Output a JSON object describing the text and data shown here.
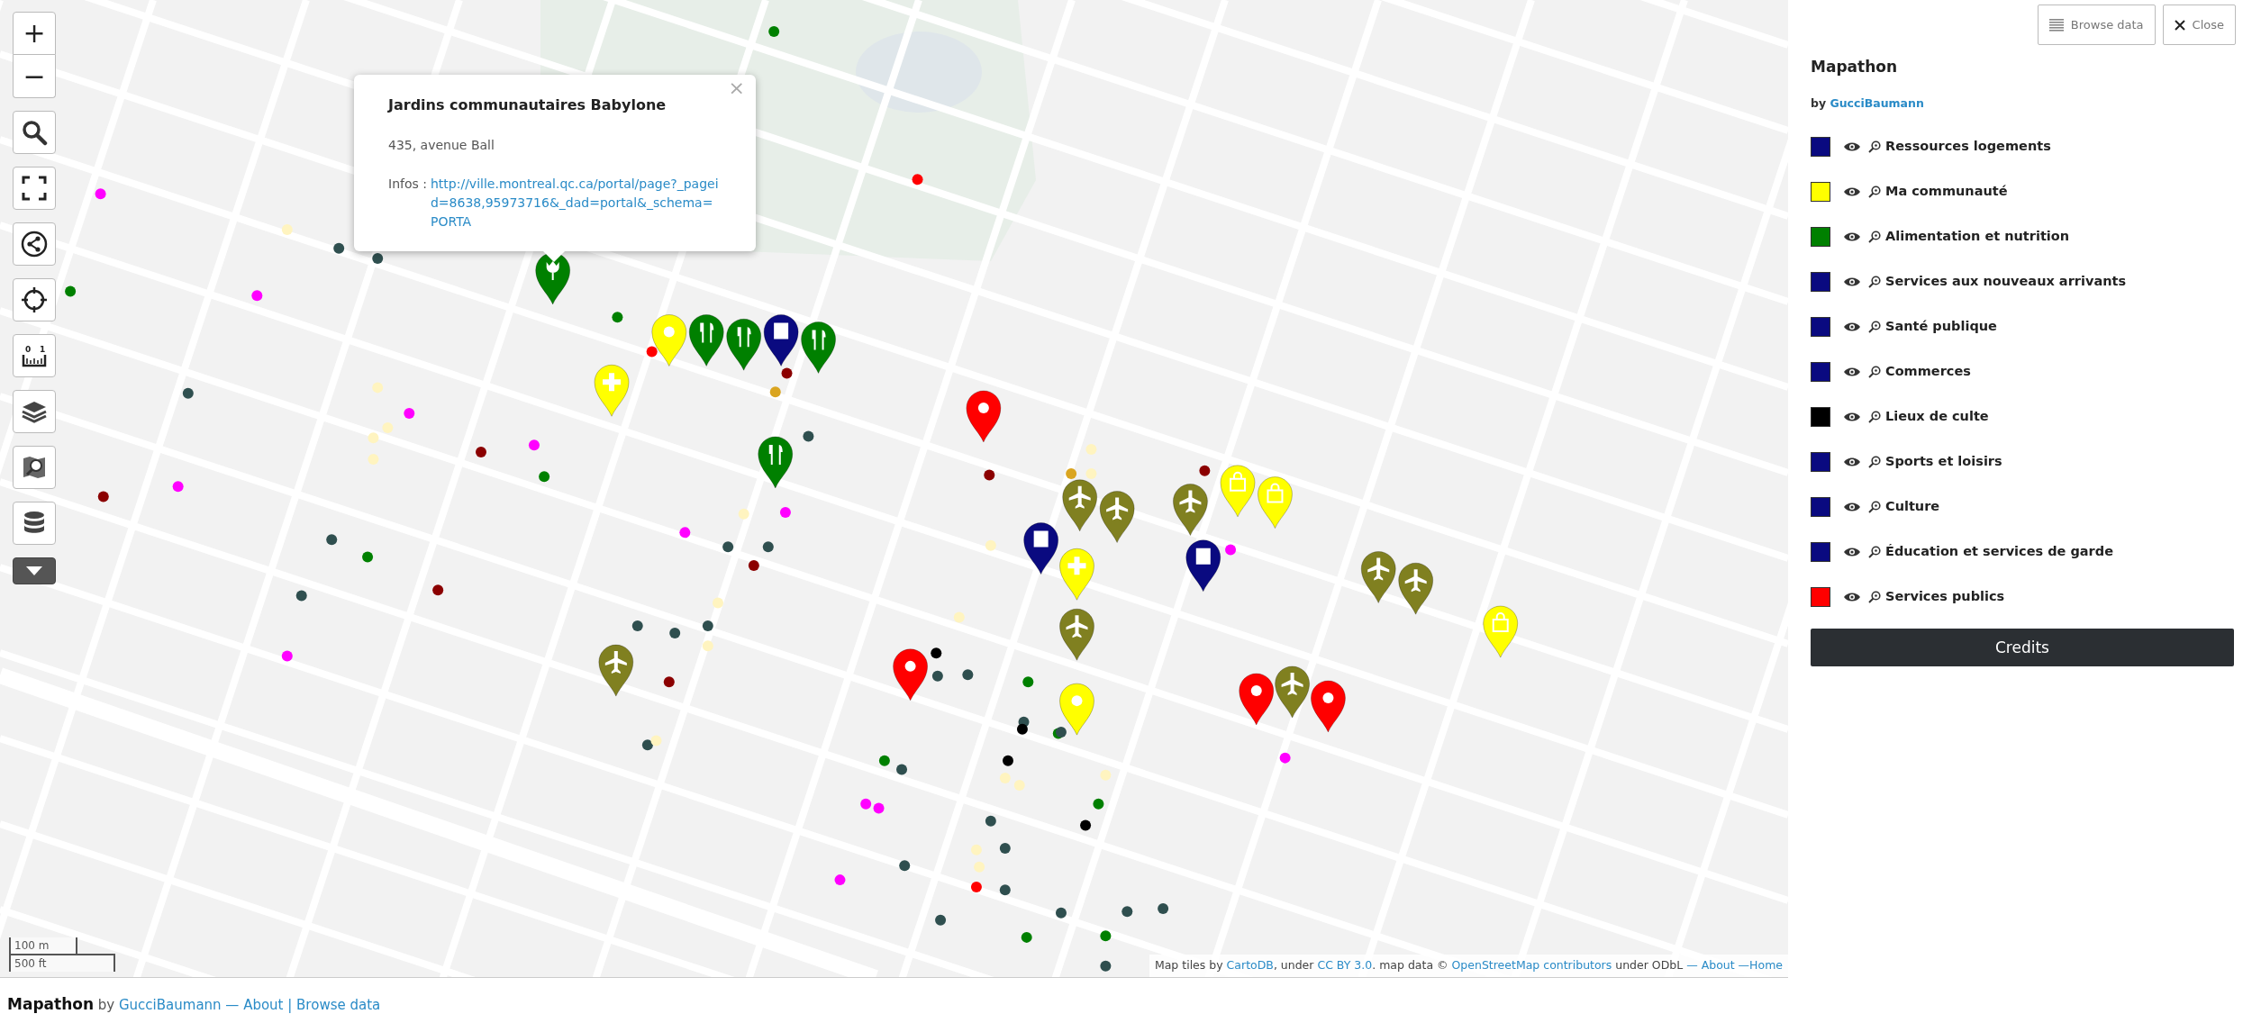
{
  "map_controls": {
    "zoom_in": "+",
    "zoom_out": "−",
    "ruler_marks": [
      "0",
      "1"
    ]
  },
  "popup": {
    "title": "Jardins communautaires Babylone",
    "close": "×",
    "address": "435, avenue Ball",
    "info_label": "Infos :",
    "info_link": "http://ville.montreal.qc.ca/portal/page?_pageid=8638,95973716&_dad=portal&_schema=PORTA"
  },
  "scale": {
    "metric": "100 m",
    "imperial": "500 ft"
  },
  "attribution": [
    {
      "kind": "text",
      "text": "Map tiles by "
    },
    {
      "kind": "link",
      "text": "CartoDB"
    },
    {
      "kind": "text",
      "text": ", under "
    },
    {
      "kind": "link",
      "text": "CC BY 3.0"
    },
    {
      "kind": "text",
      "text": ". map data © "
    },
    {
      "kind": "link",
      "text": "OpenStreetMap contributors"
    },
    {
      "kind": "text",
      "text": " under ODbL "
    },
    {
      "kind": "link",
      "text": "— About —"
    },
    {
      "kind": "link",
      "text": "Home"
    }
  ],
  "panel": {
    "buttons": [
      {
        "kind": "browse",
        "label": "Browse data"
      },
      {
        "kind": "close",
        "label": "Close"
      }
    ],
    "title": "Mapathon",
    "byline": [
      {
        "kind": "text",
        "text": "by "
      },
      {
        "kind": "link",
        "text": "GucciBaumann"
      }
    ],
    "layers": [
      {
        "name": "Ressources logements",
        "color": "#0a0a80"
      },
      {
        "name": "Ma communauté",
        "color": "#ffff00"
      },
      {
        "name": "Alimentation et nutrition",
        "color": "#008000"
      },
      {
        "name": "Services aux nouveaux arrivants",
        "color": "#0a0a80"
      },
      {
        "name": "Santé publique",
        "color": "#0a0a80"
      },
      {
        "name": "Commerces",
        "color": "#0a0a80"
      },
      {
        "name": "Lieux de culte",
        "color": "#000000"
      },
      {
        "name": "Sports et loisirs",
        "color": "#0a0a80"
      },
      {
        "name": "Culture",
        "color": "#0a0a80"
      },
      {
        "name": "Éducation et services de garde",
        "color": "#0a0a80"
      },
      {
        "name": "Services publics",
        "color": "#ff0000"
      }
    ],
    "credits_button": "Credits"
  },
  "footer": [
    {
      "kind": "title",
      "text": "Mapathon"
    },
    {
      "kind": "text",
      "text": " by "
    },
    {
      "kind": "link",
      "text": "GucciBaumann"
    },
    {
      "kind": "link",
      "text": " — About"
    },
    {
      "kind": "link",
      "text": " | Browse data"
    }
  ]
}
